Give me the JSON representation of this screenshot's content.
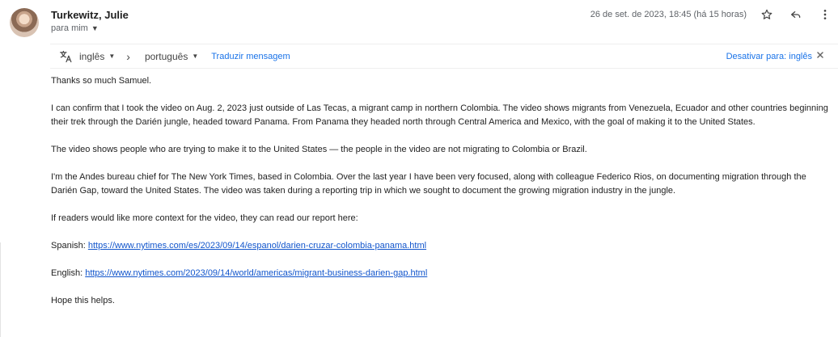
{
  "sender": {
    "name": "Turkewitz, Julie",
    "recipient": "para mim"
  },
  "timestamp": "26 de set. de 2023, 18:45 (há 15 horas)",
  "translate": {
    "source_lang": "inglês",
    "target_lang": "português",
    "translate_link": "Traduzir mensagem",
    "disable_link": "Desativar para: inglês"
  },
  "body": {
    "p1": "Thanks so much Samuel.",
    "p2": "I can confirm that I took the video on Aug. 2, 2023 just outside of Las Tecas, a migrant camp in northern Colombia. The video shows migrants from Venezuela, Ecuador and other countries beginning their trek through the Darién jungle, headed toward Panama. From Panama they headed north through Central America and Mexico, with the goal of making it to the United States.",
    "p3": "The video shows people who are trying to make it to the United States — the people in the video are not migrating to Colombia or Brazil.",
    "p4": "I'm the Andes bureau chief for The New York Times, based in Colombia. Over the last year I have been very focused, along with colleague Federico Rios, on documenting migration through the Darién Gap, toward the United States. The video was taken during a reporting trip in which we sought to document the growing migration industry in the jungle.",
    "p5": "If readers would like more context for the video, they can read our report here:",
    "spanish_label": "Spanish: ",
    "spanish_url": "https://www.nytimes.com/es/2023/09/14/espanol/darien-cruzar-colombia-panama.html",
    "english_label": "English: ",
    "english_url": "https://www.nytimes.com/2023/09/14/world/americas/migrant-business-darien-gap.html",
    "closing": "Hope this helps."
  },
  "icons": {
    "avatar": "avatar-photo",
    "star": "star-icon",
    "reply": "reply-icon",
    "more": "more-vert-icon",
    "translate": "translate-icon",
    "close": "close-icon"
  },
  "colors": {
    "link": "#1a73e8",
    "body_link": "#1155cc",
    "muted": "#5f6368"
  }
}
